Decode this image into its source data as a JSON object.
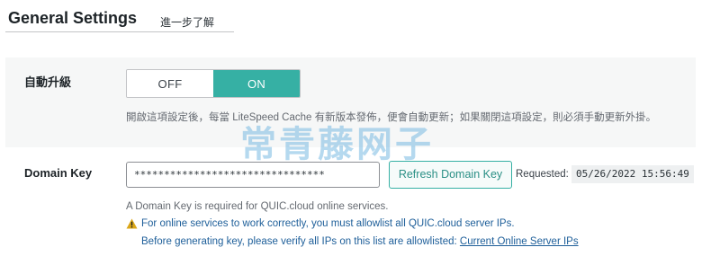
{
  "header": {
    "title": "General Settings",
    "learn_more": "進一步了解"
  },
  "auto_upgrade": {
    "label": "自動升級",
    "toggle_off": "OFF",
    "toggle_on": "ON",
    "selected": "ON",
    "description": "開啟這項設定後，每當 LiteSpeed Cache 有新版本發佈，便會自動更新；如果關閉這項設定，則必須手動更新外掛。"
  },
  "watermark": "常青藤网子",
  "domain_key": {
    "label": "Domain Key",
    "value": "********************************",
    "refresh_button": "Refresh Domain Key",
    "requested_label": "Requested:",
    "requested_date": "05/26/2022 15:56:49",
    "note_required": "A Domain Key is required for QUIC.cloud online services.",
    "note_warning": "For online services to work correctly, you must allowlist all QUIC.cloud server IPs.",
    "note_verify": "Before generating key, please verify all IPs on this list are allowlisted:",
    "ip_link": "Current Online Server IPs"
  },
  "colors": {
    "accent": "#36b0a4",
    "link": "#1d5e99",
    "warning": "#dba617"
  }
}
